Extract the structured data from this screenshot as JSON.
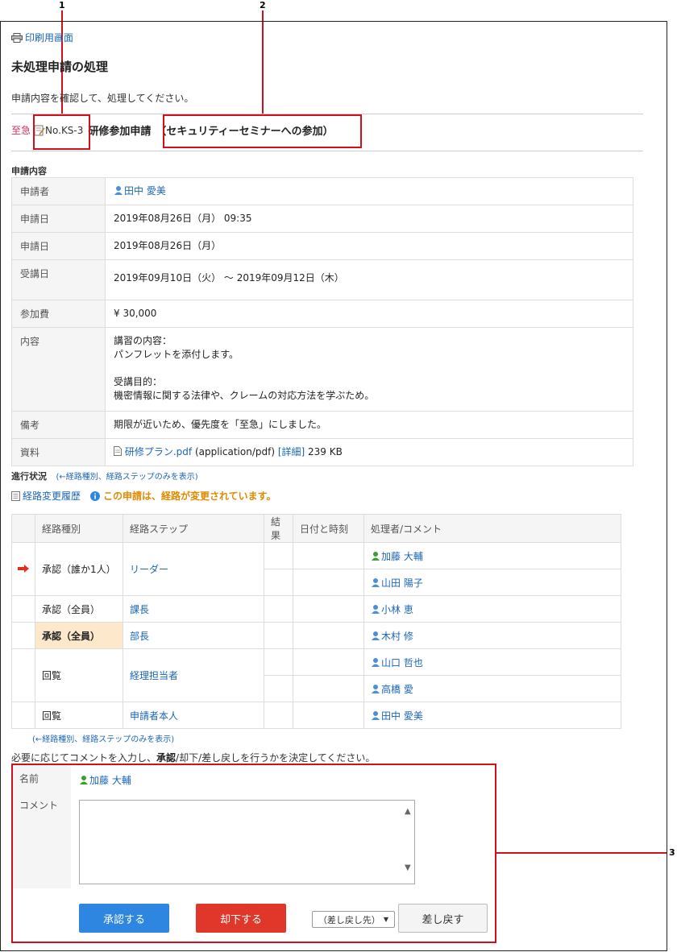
{
  "callouts": {
    "one": "1",
    "two": "2",
    "three": "3"
  },
  "print_label": "印刷用画面",
  "page_title": "未処理申請の処理",
  "instruction": "申請内容を確認して、処理してください。",
  "application": {
    "priority": "至急",
    "number": "No.KS-3",
    "form_name": "研修参加申請",
    "subject": "（セキュリティーセミナーへの参加）"
  },
  "details_heading": "申請内容",
  "details": [
    {
      "label": "申請者",
      "value": "田中 愛美",
      "type": "user"
    },
    {
      "label": "申請日",
      "value": "2019年08月26日（月） 09:35"
    },
    {
      "label": "申請日",
      "value": "2019年08月26日（月）"
    },
    {
      "label": "受講日",
      "value": "2019年09月10日（火） ～ 2019年09月12日（木）"
    },
    {
      "label": "参加費",
      "value": "¥ 30,000"
    },
    {
      "label": "内容",
      "lines": [
        "講習の内容：",
        "パンフレットを添付します。",
        "",
        "受講目的：",
        "機密情報に関する法律や、クレームの対応方法を学ぶため。"
      ]
    },
    {
      "label": "備考",
      "value": "期限が近いため、優先度を「至急」にしました。"
    },
    {
      "label": "資料",
      "file_name": "研修プラン.pdf",
      "file_type": "(application/pdf)",
      "detail_link": "[詳細]",
      "file_size": "239 KB"
    }
  ],
  "progress": {
    "heading": "進行状況",
    "toggle_link": "(←経路種別、経路ステップのみを表示)",
    "history_link": "経路変更履歴",
    "changed_notice": "この申請は、経路が変更されています。",
    "columns": [
      "経路種別",
      "経路ステップ",
      "結果",
      "日付と時刻",
      "処理者/コメント"
    ],
    "rows": [
      {
        "type": "承認（誰か1人）",
        "step": "リーダー",
        "processors": [
          "加藤 大輔",
          "山田 陽子"
        ],
        "current": true
      },
      {
        "type": "承認（全員）",
        "step": "課長",
        "processors": [
          "小林 恵"
        ]
      },
      {
        "type": "承認（全員）",
        "step": "部長",
        "processors": [
          "木村 修"
        ],
        "highlight": true
      },
      {
        "type": "回覧",
        "step": "経理担当者",
        "processors": [
          "山口 哲也",
          "高橋 愛"
        ]
      },
      {
        "type": "回覧",
        "step": "申請者本人",
        "processors": [
          "田中 愛美"
        ]
      }
    ],
    "bottom_link": "(←経路種別、経路ステップのみを表示)"
  },
  "decision": {
    "prompt_before": "必要に応じてコメントを入力し、",
    "prompt_bold": "承認",
    "prompt_after": "/却下/差し戻しを行うかを決定してください。",
    "name_label": "名前",
    "name_value": "加藤 大輔",
    "comment_label": "コメント",
    "comment_value": "",
    "approve_label": "承認する",
    "reject_label": "却下する",
    "return_select": "（差し戻し先）",
    "return_label": "差し戻す"
  },
  "colors": {
    "link": "#1a66b5",
    "accent_red": "#d0101c",
    "approve": "#2f86e0",
    "reject": "#e0372a",
    "warning": "#e08a00"
  }
}
